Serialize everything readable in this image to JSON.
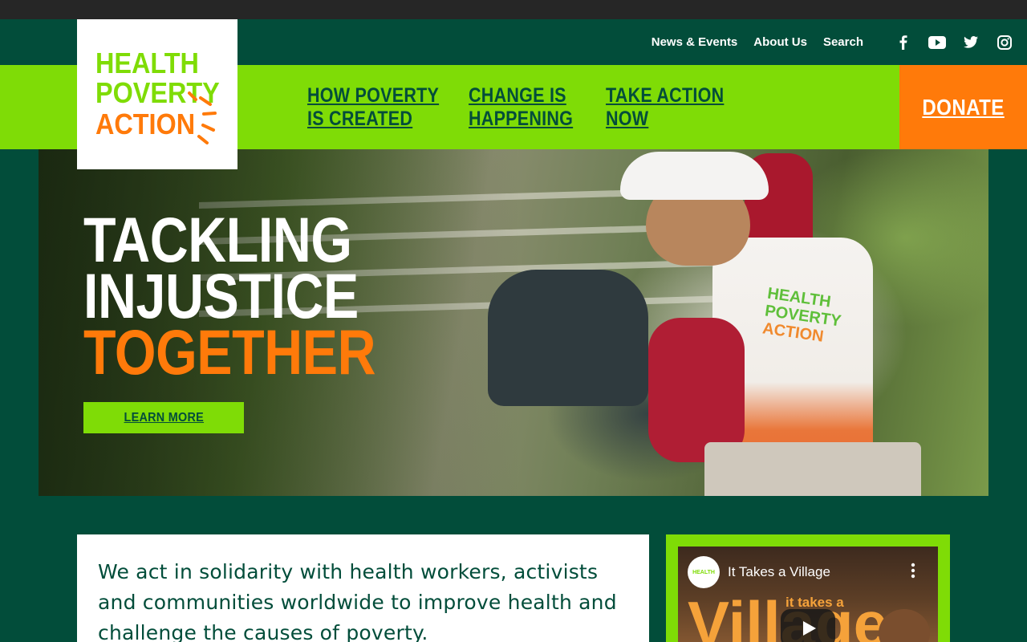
{
  "header": {
    "logo_alt": "Health Poverty Action",
    "logo_lines": [
      "HEALTH",
      "POVERTY",
      "ACTION"
    ],
    "utility_links": [
      {
        "label": "News & Events"
      },
      {
        "label": "About Us"
      },
      {
        "label": "Search"
      }
    ],
    "social_icons": [
      "facebook-icon",
      "youtube-icon",
      "twitter-icon",
      "instagram-icon"
    ]
  },
  "nav": {
    "items": [
      {
        "line1": "HOW POVERTY",
        "line2": "IS CREATED"
      },
      {
        "line1": "CHANGE IS",
        "line2": "HAPPENING"
      },
      {
        "line1": "TAKE ACTION",
        "line2": "NOW"
      }
    ],
    "donate_label": "DONATE"
  },
  "hero": {
    "title_line1": "TACKLING",
    "title_line2": "INJUSTICE",
    "title_line3": "TOGETHER",
    "cta_label": "LEARN MORE",
    "vest_logo_lines": [
      "HEALTH",
      "POVERTY",
      "ACTION"
    ]
  },
  "intro": {
    "text": "We act in solidarity with health workers, activists and communities worldwide to improve health and challenge the causes of poverty."
  },
  "video": {
    "title": "It Takes a Village",
    "overlay_small": "it takes a",
    "overlay_big": "Village",
    "channel_logo_lines": [
      "HEALTH",
      "POVERTY",
      "ACTION"
    ]
  },
  "colors": {
    "dark_green": "#024d3a",
    "lime": "#7fdc06",
    "orange": "#ff7a0a",
    "white": "#ffffff"
  }
}
